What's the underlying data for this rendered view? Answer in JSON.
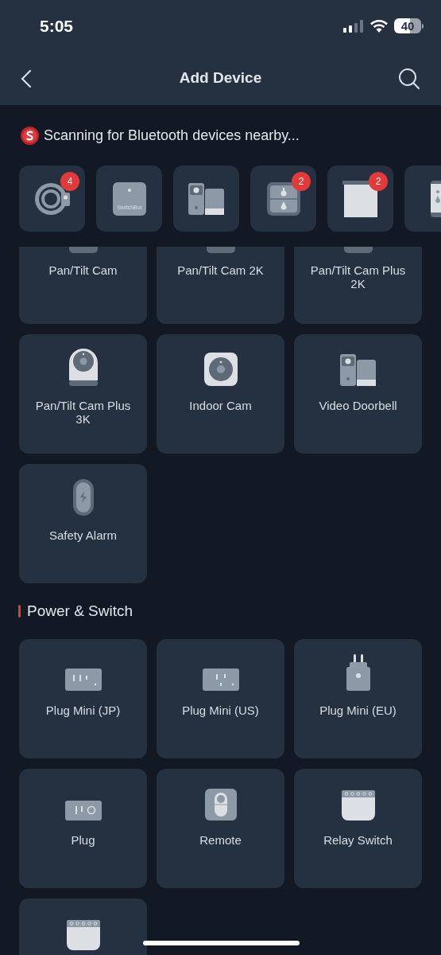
{
  "status_bar": {
    "time": "5:05",
    "battery": "40"
  },
  "header": {
    "title": "Add Device"
  },
  "scan": {
    "message": "Scanning for Bluetooth devices nearby..."
  },
  "nearby_devices": [
    {
      "kind": "lock",
      "badge": "4"
    },
    {
      "kind": "hub",
      "label": "SwitchBot"
    },
    {
      "kind": "doorbell"
    },
    {
      "kind": "sensor",
      "badge": "2"
    },
    {
      "kind": "curtain",
      "badge": "2"
    },
    {
      "kind": "meter"
    }
  ],
  "device_groups": [
    {
      "devices": [
        {
          "kind": "camera_cut",
          "label": "Pan/Tilt Cam"
        },
        {
          "kind": "camera_cut",
          "label": "Pan/Tilt Cam 2K"
        },
        {
          "kind": "camera_cut",
          "label": "Pan/Tilt Cam Plus 2K"
        },
        {
          "kind": "pantilt",
          "label": "Pan/Tilt Cam Plus 3K"
        },
        {
          "kind": "indoor",
          "label": "Indoor Cam"
        },
        {
          "kind": "doorbell",
          "label": "Video Doorbell"
        },
        {
          "kind": "alarm",
          "label": "Safety Alarm"
        }
      ]
    },
    {
      "title": "Power & Switch",
      "devices": [
        {
          "kind": "plug_jp",
          "label": "Plug Mini (JP)"
        },
        {
          "kind": "plug_us",
          "label": "Plug Mini (US)"
        },
        {
          "kind": "plug_eu",
          "label": "Plug Mini (EU)"
        },
        {
          "kind": "plug",
          "label": "Plug"
        },
        {
          "kind": "remote",
          "label": "Remote"
        },
        {
          "kind": "relay",
          "label": "Relay Switch"
        },
        {
          "kind": "relay"
        }
      ]
    }
  ]
}
